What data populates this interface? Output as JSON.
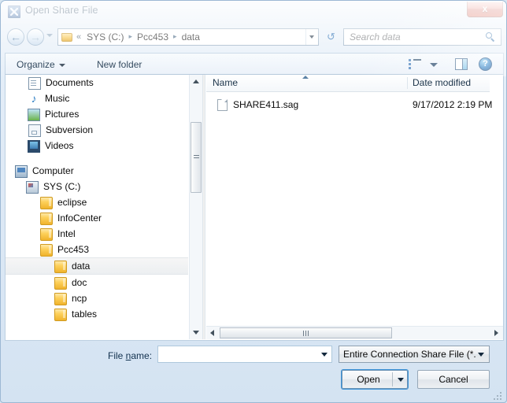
{
  "window": {
    "title": "Open Share File",
    "app_icon": "share-file-icon",
    "close_label": "x"
  },
  "nav": {
    "back_icon": "back-arrow-icon",
    "back_glyph": "←",
    "forward_icon": "forward-arrow-icon",
    "forward_glyph": "→",
    "recent_icon": "chevron-down-icon",
    "refresh_icon": "refresh-icon",
    "refresh_glyph": "↺",
    "folder_icon": "folder-icon",
    "overflow_chevrons": "«",
    "breadcrumbs": [
      "SYS (C:)",
      "Pcc453",
      "data"
    ],
    "separator": "▸",
    "dropdown_icon": "chevron-down-icon"
  },
  "search": {
    "placeholder": "Search data",
    "icon": "search-icon"
  },
  "toolbar": {
    "organize_label": "Organize",
    "new_folder_label": "New folder",
    "view_icon": "view-mode-icon",
    "view_caret_icon": "chevron-down-icon",
    "preview_pane_icon": "preview-pane-icon",
    "help_icon": "help-icon",
    "help_glyph": "?"
  },
  "nav_pane": {
    "items": [
      {
        "label": "Documents",
        "icon": "documents-icon",
        "icon_class": "ico-doc",
        "indent": 28,
        "selected": false
      },
      {
        "label": "Music",
        "icon": "music-icon",
        "icon_class": "ico-music",
        "indent": 28,
        "selected": false,
        "glyph": "♪"
      },
      {
        "label": "Pictures",
        "icon": "pictures-icon",
        "icon_class": "ico-pic",
        "indent": 28,
        "selected": false
      },
      {
        "label": "Subversion",
        "icon": "subversion-icon",
        "icon_class": "ico-sub",
        "indent": 28,
        "selected": false
      },
      {
        "label": "Videos",
        "icon": "videos-icon",
        "icon_class": "ico-video",
        "indent": 28,
        "selected": false
      },
      {
        "label": "",
        "icon": "spacer",
        "icon_class": "spacer",
        "indent": 0,
        "selected": false,
        "spacer": true
      },
      {
        "label": "Computer",
        "icon": "computer-icon",
        "icon_class": "ico-computer",
        "indent": 12,
        "selected": false
      },
      {
        "label": "SYS (C:)",
        "icon": "drive-icon",
        "icon_class": "ico-drive",
        "indent": 26,
        "selected": false
      },
      {
        "label": "eclipse",
        "icon": "folder-icon",
        "icon_class": "ico-folder",
        "indent": 44,
        "selected": false
      },
      {
        "label": "InfoCenter",
        "icon": "folder-icon",
        "icon_class": "ico-folder",
        "indent": 44,
        "selected": false
      },
      {
        "label": "Intel",
        "icon": "folder-icon",
        "icon_class": "ico-folder",
        "indent": 44,
        "selected": false
      },
      {
        "label": "Pcc453",
        "icon": "folder-icon",
        "icon_class": "ico-folder",
        "indent": 44,
        "selected": false
      },
      {
        "label": "data",
        "icon": "folder-icon",
        "icon_class": "ico-folder",
        "indent": 62,
        "selected": true
      },
      {
        "label": "doc",
        "icon": "folder-icon",
        "icon_class": "ico-folder",
        "indent": 62,
        "selected": false
      },
      {
        "label": "ncp",
        "icon": "folder-icon",
        "icon_class": "ico-folder",
        "indent": 62,
        "selected": false
      },
      {
        "label": "tables",
        "icon": "folder-icon",
        "icon_class": "ico-folder",
        "indent": 62,
        "selected": false
      }
    ]
  },
  "file_list": {
    "columns": [
      "Name",
      "Date modified"
    ],
    "sort_indicator": "sort-ascending-icon",
    "rows": [
      {
        "name": "SHARE411.sag",
        "date_modified": "9/17/2012 2:19 PM",
        "icon": "file-icon"
      }
    ]
  },
  "form": {
    "file_name_label_pre": "File ",
    "file_name_label_accel": "n",
    "file_name_label_post": "ame:",
    "file_name_value": "",
    "file_type_value": "Entire Connection Share File (*.",
    "open_label": "Open",
    "cancel_label": "Cancel"
  },
  "colors": {
    "accent": "#3c93d8",
    "close_red": "#c3392c",
    "folder_yellow": "#f0b32c",
    "title_text": "#12314f"
  }
}
